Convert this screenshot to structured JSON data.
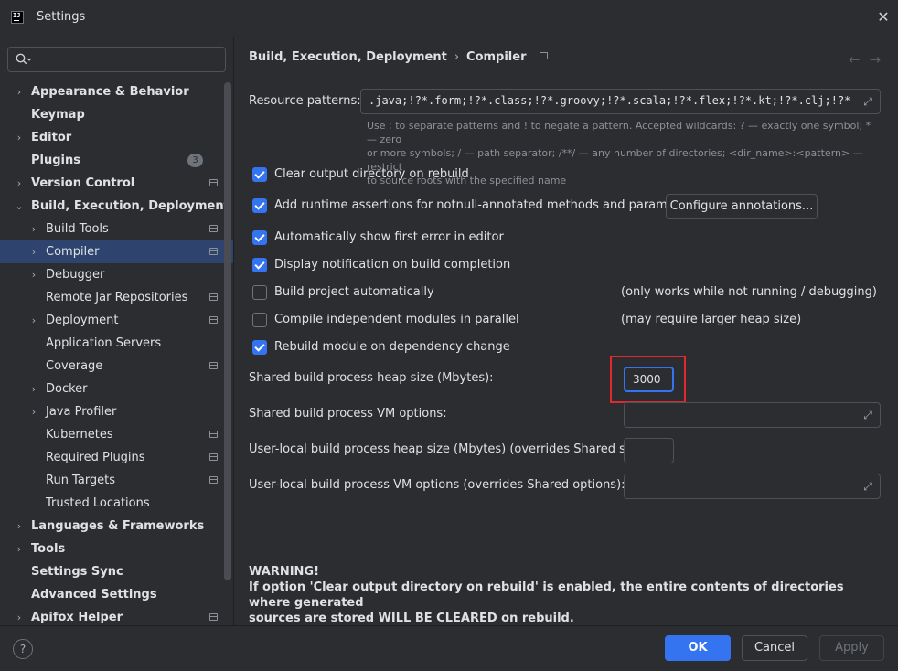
{
  "window": {
    "title": "Settings",
    "app_icon_text": "IJ"
  },
  "search": {
    "placeholder": "",
    "value": ""
  },
  "sidebar": {
    "items": [
      {
        "label": "Appearance & Behavior",
        "level": 0,
        "chevron": "›",
        "proj": false
      },
      {
        "label": "Keymap",
        "level": 0,
        "chevron": "",
        "proj": false
      },
      {
        "label": "Editor",
        "level": 0,
        "chevron": "›",
        "proj": false
      },
      {
        "label": "Plugins",
        "level": 0,
        "chevron": "",
        "proj": false,
        "count": "3"
      },
      {
        "label": "Version Control",
        "level": 0,
        "chevron": "›",
        "proj": true
      },
      {
        "label": "Build, Execution, Deployment",
        "level": 0,
        "chevron": "⌄",
        "proj": false
      },
      {
        "label": "Build Tools",
        "level": 1,
        "chevron": "›",
        "proj": true
      },
      {
        "label": "Compiler",
        "level": 1,
        "chevron": "›",
        "proj": true,
        "selected": true
      },
      {
        "label": "Debugger",
        "level": 1,
        "chevron": "›",
        "proj": false
      },
      {
        "label": "Remote Jar Repositories",
        "level": 1,
        "chevron": "",
        "proj": true
      },
      {
        "label": "Deployment",
        "level": 1,
        "chevron": "›",
        "proj": true
      },
      {
        "label": "Application Servers",
        "level": 1,
        "chevron": "",
        "proj": false
      },
      {
        "label": "Coverage",
        "level": 1,
        "chevron": "",
        "proj": true
      },
      {
        "label": "Docker",
        "level": 1,
        "chevron": "›",
        "proj": false
      },
      {
        "label": "Java Profiler",
        "level": 1,
        "chevron": "›",
        "proj": false
      },
      {
        "label": "Kubernetes",
        "level": 1,
        "chevron": "",
        "proj": true
      },
      {
        "label": "Required Plugins",
        "level": 1,
        "chevron": "",
        "proj": true
      },
      {
        "label": "Run Targets",
        "level": 1,
        "chevron": "",
        "proj": true
      },
      {
        "label": "Trusted Locations",
        "level": 1,
        "chevron": "",
        "proj": false
      },
      {
        "label": "Languages & Frameworks",
        "level": 0,
        "chevron": "›",
        "proj": false
      },
      {
        "label": "Tools",
        "level": 0,
        "chevron": "›",
        "proj": false
      },
      {
        "label": "Settings Sync",
        "level": 0,
        "chevron": "",
        "proj": false
      },
      {
        "label": "Advanced Settings",
        "level": 0,
        "chevron": "",
        "proj": false
      },
      {
        "label": "Apifox Helper",
        "level": 0,
        "chevron": "›",
        "proj": true
      }
    ]
  },
  "breadcrumb": {
    "parent": "Build, Execution, Deployment",
    "sep": "›",
    "current": "Compiler"
  },
  "nav": {
    "back": "←",
    "forward": "→"
  },
  "resource_patterns": {
    "label": "Resource patterns:",
    "value": ".java;!?*.form;!?*.class;!?*.groovy;!?*.scala;!?*.flex;!?*.kt;!?*.clj;!?*.aj",
    "help_line1": "Use ; to separate patterns and ! to negate a pattern. Accepted wildcards: ? — exactly one symbol; * — zero",
    "help_line2": "or more symbols; / — path separator; /**/ — any number of directories; <dir_name>:<pattern> — restrict",
    "help_line3": "to source roots with the specified name"
  },
  "options": {
    "clear_output": {
      "label": "Clear output directory on rebuild",
      "checked": true
    },
    "runtime_assertions": {
      "label": "Add runtime assertions for notnull-annotated methods and parameters",
      "checked": true
    },
    "configure_annotations": "Configure annotations...",
    "show_first_error": {
      "label": "Automatically show first error in editor",
      "checked": true
    },
    "notify_completion": {
      "label": "Display notification on build completion",
      "checked": true
    },
    "build_auto": {
      "label": "Build project automatically",
      "checked": false,
      "hint": "(only works while not running / debugging)"
    },
    "compile_parallel": {
      "label": "Compile independent modules in parallel",
      "checked": false,
      "hint": "(may require larger heap size)"
    },
    "rebuild_module": {
      "label": "Rebuild module on dependency change",
      "checked": true
    }
  },
  "heap": {
    "label": "Shared build process heap size (Mbytes):",
    "value": "3000"
  },
  "vm_options": {
    "label": "Shared build process VM options:",
    "value": ""
  },
  "user_heap": {
    "label": "User-local build process heap size (Mbytes) (overrides Shared size):",
    "value": ""
  },
  "user_vm": {
    "label": "User-local build process VM options (overrides Shared options):",
    "value": ""
  },
  "warning": {
    "title": "WARNING!",
    "line1": "If option 'Clear output directory on rebuild' is enabled, the entire contents of directories where generated",
    "line2": "sources are stored WILL BE CLEARED on rebuild."
  },
  "footer": {
    "help": "?",
    "ok": "OK",
    "cancel": "Cancel",
    "apply": "Apply"
  },
  "colors": {
    "accent": "#3574f0",
    "highlight": "#e0282e",
    "background": "#2b2d30",
    "selected": "#2e436e"
  }
}
